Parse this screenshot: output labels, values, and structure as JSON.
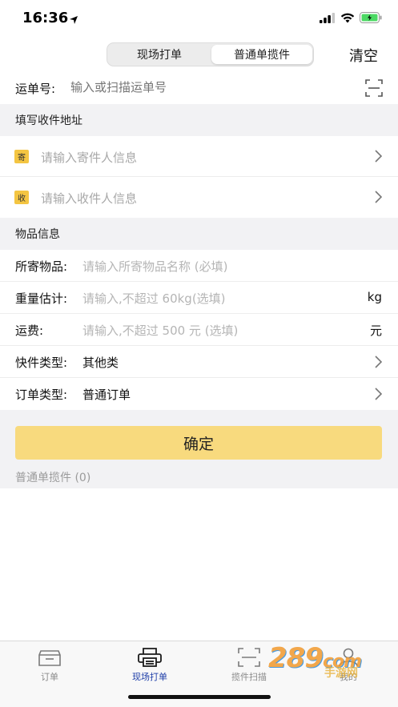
{
  "status_bar": {
    "time": "16:36"
  },
  "header": {
    "segments": [
      "现场打单",
      "普通单揽件"
    ],
    "active_segment": 1,
    "clear_label": "清空"
  },
  "waybill": {
    "label": "运单号:",
    "placeholder": "输入或扫描运单号"
  },
  "address_section": {
    "title": "填写收件地址",
    "sender": {
      "tag": "寄",
      "placeholder": "请输入寄件人信息"
    },
    "receiver": {
      "tag": "收",
      "placeholder": "请输入收件人信息"
    }
  },
  "item_section": {
    "title": "物品信息",
    "item_name": {
      "label": "所寄物品:",
      "placeholder": "请输入所寄物品名称 (必填)"
    },
    "weight": {
      "label": "重量估计:",
      "placeholder": "请输入,不超过 60kg(选填)",
      "unit": "kg"
    },
    "freight": {
      "label": "运费:",
      "placeholder": "请输入,不超过 500 元 (选填)",
      "unit": "元"
    },
    "parcel_type": {
      "label": "快件类型:",
      "value": "其他类"
    },
    "order_type": {
      "label": "订单类型:",
      "value": "普通订单"
    }
  },
  "confirm": {
    "button_label": "确定",
    "count_text": "普通单揽件 (0)"
  },
  "tab_bar": {
    "tabs": [
      {
        "label": "订单",
        "icon": "inbox-icon"
      },
      {
        "label": "现场打单",
        "icon": "printer-icon"
      },
      {
        "label": "揽件扫描",
        "icon": "scan-icon"
      },
      {
        "label": "我的",
        "icon": "user-icon"
      }
    ],
    "active_index": 1
  },
  "watermark": {
    "text": "289",
    "suffix": "com",
    "sub": "手游网"
  },
  "colors": {
    "accent_yellow": "#f8da7e",
    "tag_yellow": "#f4c542",
    "section_bg": "#f2f2f4",
    "active_tab": "#1e3ea8",
    "battery_green": "#4cd964"
  }
}
